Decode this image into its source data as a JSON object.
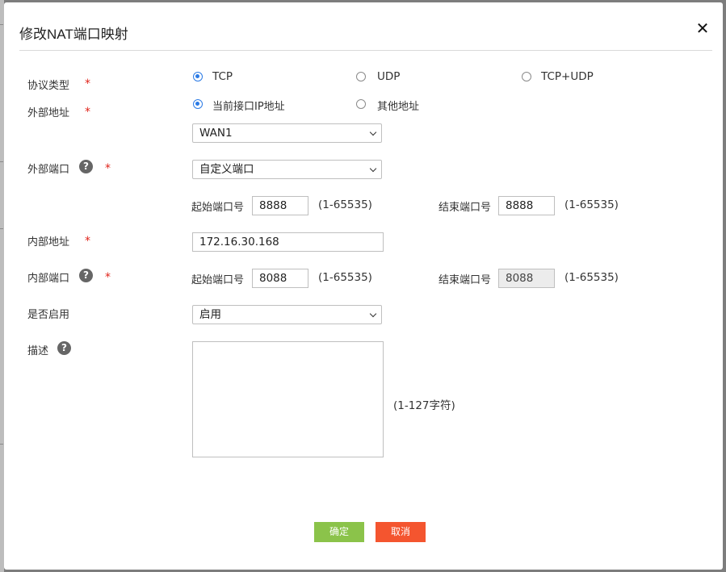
{
  "dialog": {
    "title": "修改NAT端口映射",
    "close_glyph": "✕"
  },
  "protocol": {
    "label": "协议类型",
    "options": [
      "TCP",
      "UDP",
      "TCP+UDP"
    ],
    "selected": "TCP"
  },
  "external_address": {
    "label": "外部地址",
    "options": [
      "当前接口IP地址",
      "其他地址"
    ],
    "selected": "当前接口IP地址",
    "interface_value": "WAN1"
  },
  "external_port": {
    "label": "外部端口",
    "help_glyph": "?",
    "mode_value": "自定义端口",
    "start_label": "起始端口号",
    "start_value": "8888",
    "start_range": "(1-65535)",
    "end_label": "结束端口号",
    "end_value": "8888",
    "end_range": "(1-65535)"
  },
  "internal_address": {
    "label": "内部地址",
    "value": "172.16.30.168"
  },
  "internal_port": {
    "label": "内部端口",
    "help_glyph": "?",
    "start_label": "起始端口号",
    "start_value": "8088",
    "start_range": "(1-65535)",
    "end_label": "结束端口号",
    "end_value": "8088",
    "end_range": "(1-65535)"
  },
  "enable": {
    "label": "是否启用",
    "value": "启用"
  },
  "description": {
    "label": "描述",
    "help_glyph": "?",
    "value": "",
    "hint": "(1-127字符)"
  },
  "required_mark": "*",
  "buttons": {
    "ok": "确定",
    "cancel": "取消"
  },
  "colors": {
    "accent": "#2c7be5",
    "ok_button": "#8bc34a",
    "cancel_button": "#f4552f",
    "required": "#e0241b"
  }
}
